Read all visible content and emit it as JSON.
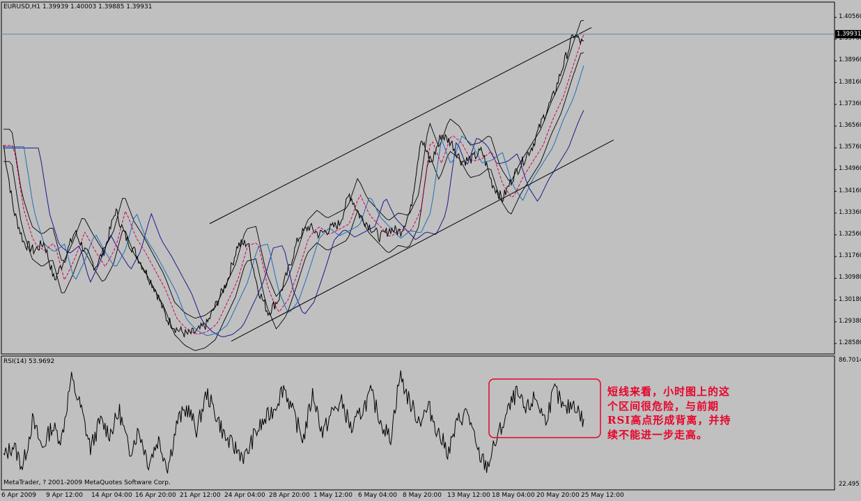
{
  "main_panel": {
    "header": "EURUSD,H1  1.39939 1.40003 1.39885 1.39931",
    "current_price": "1.39931",
    "y_labels": [
      "1.40560",
      "1.39760",
      "1.38960",
      "1.38160",
      "1.37360",
      "1.36560",
      "1.35760",
      "1.34960",
      "1.34160",
      "1.33360",
      "1.32560",
      "1.31760",
      "1.30980",
      "1.30180",
      "1.29380",
      "1.28580"
    ]
  },
  "rsi_panel": {
    "header": "RSI(14) 53.9692",
    "top_label": "86.7014",
    "bottom_label": "22.495"
  },
  "x_labels": [
    "6 Apr 2009",
    "9 Apr 12:00",
    "14 Apr 04:00",
    "16 Apr 20:00",
    "21 Apr 12:00",
    "24 Apr 04:00",
    "28 Apr 20:00",
    "1 May 12:00",
    "6 May 04:00",
    "8 May 20:00",
    "13 May 12:00",
    "18 May 04:00",
    "20 May 20:00",
    "25 May 12:00"
  ],
  "copyright": "MetaTrader, ? 2001-2009 MetaQuotes Software Corp.",
  "annotation": {
    "lines": [
      "短线来看，小时图上的这",
      "个区间很危险，与前期",
      "RSI高点形成背离，并持",
      "续不能进一步走高。"
    ],
    "color": "#e8002a"
  },
  "colors": {
    "background": "#c0c0c0",
    "ma_fast": "#d4005a",
    "ma_mid": "#1f6fb8",
    "ma_slow": "#1a1a8c",
    "price": "#000000",
    "annotation_box": "#e8002a"
  },
  "chart_data": [
    {
      "type": "line",
      "title": "EURUSD,H1",
      "ylim": [
        1.2858,
        1.4096
      ],
      "x_tick_labels": [
        "6 Apr 2009",
        "9 Apr 12:00",
        "14 Apr 04:00",
        "16 Apr 20:00",
        "21 Apr 12:00",
        "24 Apr 04:00",
        "28 Apr 20:00",
        "1 May 12:00",
        "6 May 04:00",
        "8 May 20:00",
        "13 May 12:00",
        "18 May 04:00",
        "20 May 20:00",
        "25 May 12:00"
      ],
      "series": [
        {
          "values": [
            1.362,
            1.338,
            1.326,
            1.323,
            1.326,
            1.312,
            1.32,
            1.33,
            1.323,
            1.317,
            1.324,
            1.338,
            1.328,
            1.322,
            1.315,
            1.308,
            1.298,
            1.294,
            1.292,
            1.293,
            1.296,
            1.304,
            1.312,
            1.325,
            1.326,
            1.309,
            1.3,
            1.305,
            1.316,
            1.328,
            1.332,
            1.329,
            1.331,
            1.333,
            1.344,
            1.336,
            1.332,
            1.328,
            1.331,
            1.33,
            1.338,
            1.365,
            1.355,
            1.366,
            1.363,
            1.356,
            1.357,
            1.36,
            1.348,
            1.342,
            1.35,
            1.356,
            1.362,
            1.372,
            1.38,
            1.392,
            1.403,
            1.3993
          ]
        }
      ],
      "channel": {
        "upper": [
          {
            "x": "24 Apr",
            "y": 1.333
          },
          {
            "x": "25 May",
            "y": 1.4056
          }
        ],
        "lower": [
          {
            "x": "22 Apr",
            "y": 1.2895
          },
          {
            "x": "25 May",
            "y": 1.364
          }
        ]
      }
    },
    {
      "type": "line",
      "title": "RSI(14) 53.9692",
      "ylim": [
        22.495,
        86.7014
      ],
      "series": [
        {
          "values": [
            35,
            42,
            30,
            55,
            40,
            52,
            45,
            78,
            62,
            40,
            55,
            48,
            60,
            38,
            50,
            32,
            45,
            30,
            55,
            62,
            50,
            70,
            58,
            45,
            40,
            35,
            48,
            55,
            62,
            74,
            58,
            45,
            70,
            48,
            60,
            65,
            50,
            60,
            70,
            55,
            45,
            80,
            65,
            55,
            62,
            48,
            38,
            55,
            60,
            38,
            30,
            45,
            58,
            70,
            60,
            68,
            55,
            72,
            60,
            65,
            54
          ]
        }
      ]
    }
  ]
}
